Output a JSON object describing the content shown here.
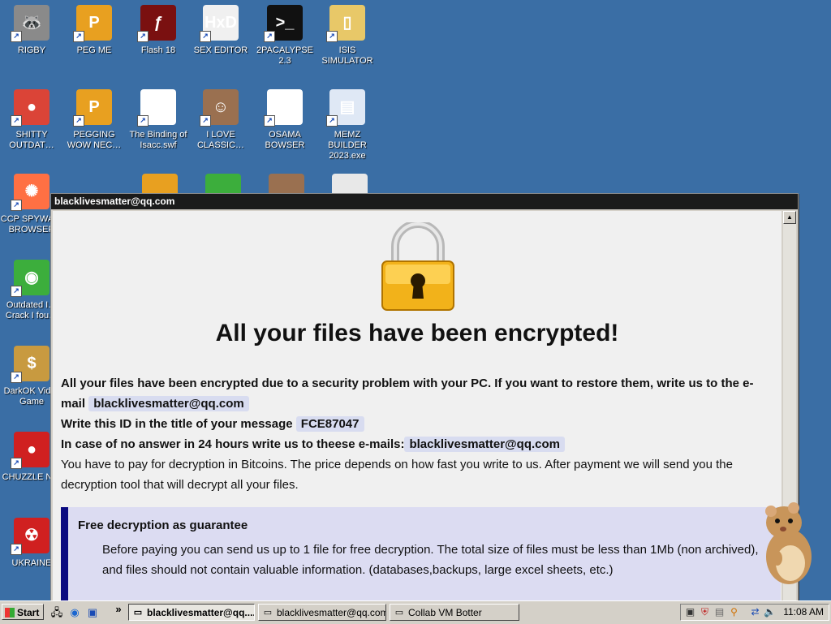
{
  "desktop_icons": [
    {
      "label": "RIGBY",
      "icon": "raccoon-icon",
      "color": "#8a8a8a",
      "glyph": "🦝"
    },
    {
      "label": "PEG ME",
      "icon": "p-logo-icon",
      "color": "#e8a020",
      "glyph": "P"
    },
    {
      "label": "Flash 18",
      "icon": "flash-icon",
      "color": "#7a1010",
      "glyph": "ƒ"
    },
    {
      "label": "SEX EDITOR",
      "icon": "hxd-icon",
      "color": "#f0f0f0",
      "glyph": "HxD"
    },
    {
      "label": "2PACALYPSE 2.3",
      "icon": "terminal-icon",
      "color": "#111111",
      "glyph": ">_"
    },
    {
      "label": "ISIS SIMULATOR",
      "icon": "folder-icon",
      "color": "#e8c868",
      "glyph": "▯"
    },
    {
      "label": "SHITTY OUTDAT…",
      "icon": "chrome-icon",
      "color": "#db4437",
      "glyph": "●"
    },
    {
      "label": "PEGGING WOW NEC…",
      "icon": "p-logo-icon",
      "color": "#e8a020",
      "glyph": "P"
    },
    {
      "label": "The Binding of Isacc.swf",
      "icon": "swf-file-icon",
      "color": "#ffffff",
      "glyph": "ƒ"
    },
    {
      "label": "I LOVE CLASSIC…",
      "icon": "portrait-icon",
      "color": "#9a7050",
      "glyph": "☺"
    },
    {
      "label": "OSAMA BOWSER",
      "icon": "obama-logo-icon",
      "color": "#ffffff",
      "glyph": "◒"
    },
    {
      "label": "MEMZ BUILDER 2023.exe",
      "icon": "window-exe-icon",
      "color": "#dfe8f5",
      "glyph": "▤"
    },
    {
      "label": "CCP SPYWA… BROWSER",
      "icon": "pinwheel-icon",
      "color": "#ff7043",
      "glyph": "✺"
    },
    {
      "label": "Outdated I… Crack I fou…",
      "icon": "download-globe-icon",
      "color": "#3cae3c",
      "glyph": "◉"
    },
    {
      "label": "DarkOK Vid… Game",
      "icon": "money-bag-icon",
      "color": "#c89a40",
      "glyph": "$"
    },
    {
      "label": "CHUZZLE N…",
      "icon": "chuzzle-icon",
      "color": "#d02020",
      "glyph": "●"
    },
    {
      "label": "UKRAINE",
      "icon": "radiation-icon",
      "color": "#d02020",
      "glyph": "☢"
    }
  ],
  "ransom_window": {
    "title": "blacklivesmatter@qq.com",
    "headline": "All your files have been encrypted!",
    "line1": "All your files have been encrypted due to a security problem with your PC. If you want to restore them, write us to the e-mail",
    "email": "blacklivesmatter@qq.com",
    "id_prefix": "Write this ID in the title of your message",
    "id_value": "FCE87047",
    "no_answer_prefix": "In case of no answer in 24 hours write us to theese e-mails:",
    "email2": "blacklivesmatter@qq.com",
    "pay_text": "You have to pay for decryption in Bitcoins. The price depends on how fast you write to us. After payment we will send you the decryption tool that will decrypt all your files.",
    "guarantee_title": "Free decryption as guarantee",
    "guarantee_text": "Before paying you can send us up to 1 file for free decryption. The total size of files must be less than 1Mb (non archived), and files should not contain valuable information. (databases,backups, large excel sheets, etc.)"
  },
  "taskbar": {
    "start_label": "Start",
    "quick_launch_chevron": "»",
    "buttons": [
      {
        "label": "blacklivesmatter@qq....",
        "icon": "window-icon",
        "active": true
      },
      {
        "label": "blacklivesmatter@qq.com",
        "icon": "window-icon",
        "active": false
      },
      {
        "label": "Collab VM Botter",
        "icon": "app-icon",
        "active": false
      }
    ],
    "clock": "11:08 AM"
  },
  "colors": {
    "desktop_bg": "#3a6ea5",
    "window_title_bg": "#1b1b1b",
    "guarantee_bar": "#0a0a80",
    "guarantee_bg": "#dcdcf2",
    "highlight_bg": "#d8dcf0"
  }
}
